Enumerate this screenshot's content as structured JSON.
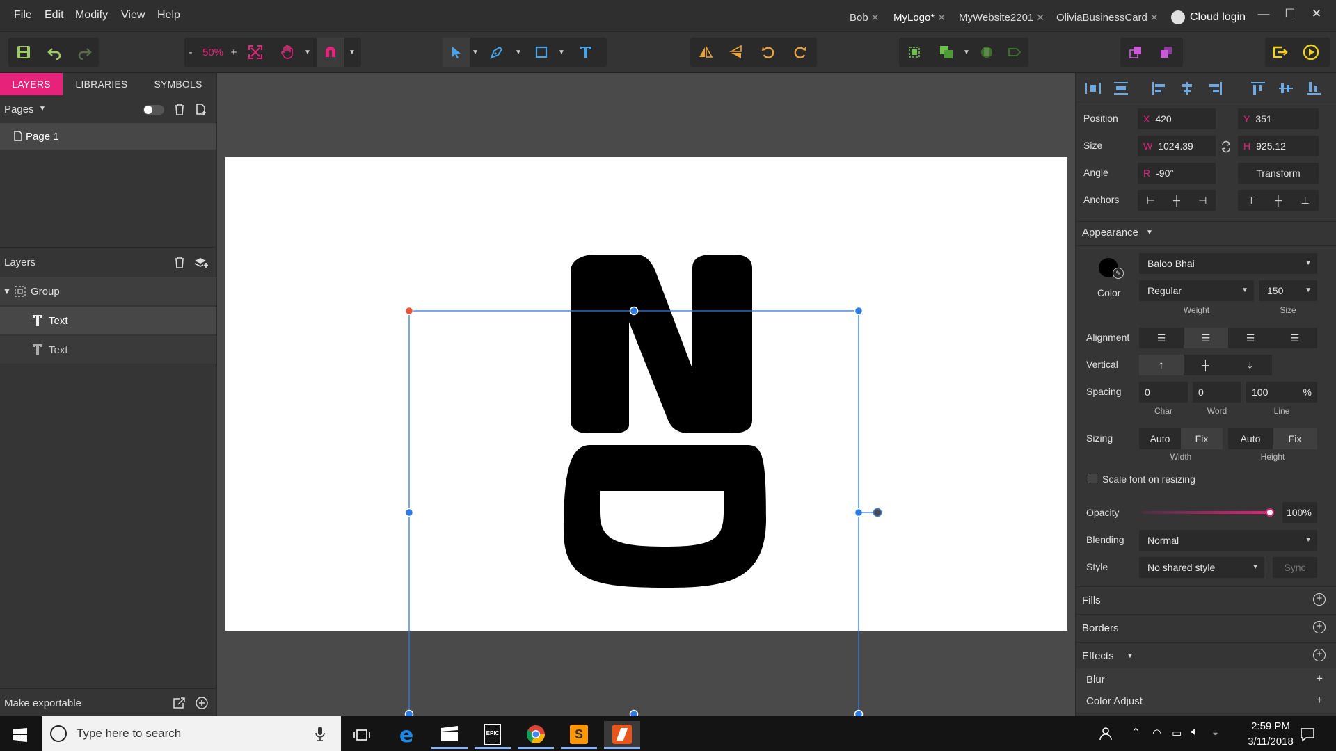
{
  "menu": [
    "File",
    "Edit",
    "Modify",
    "View",
    "Help"
  ],
  "doc_tabs": [
    {
      "label": "Bob",
      "active": false
    },
    {
      "label": "MyLogo*",
      "active": true
    },
    {
      "label": "MyWebsite2201",
      "active": false
    },
    {
      "label": "OliviaBusinessCard",
      "active": false
    }
  ],
  "cloud_login": "Cloud login",
  "toolbar": {
    "zoom_minus": "-",
    "zoom_value": "50%",
    "zoom_plus": "+"
  },
  "left_panel": {
    "tabs": [
      "LAYERS",
      "LIBRARIES",
      "SYMBOLS"
    ],
    "pages_label": "Pages",
    "page_item": "Page 1",
    "layers_label": "Layers",
    "layer_items": [
      {
        "label": "Group",
        "type": "group"
      },
      {
        "label": "Text",
        "type": "text",
        "selected": true
      },
      {
        "label": "Text",
        "type": "text",
        "selected": false
      }
    ],
    "make_exportable": "Make exportable"
  },
  "canvas": {
    "artboard_text": [
      "N",
      "D"
    ],
    "text_color": "#000000",
    "selection_color": "#2f7be5",
    "anchor_color": "#e8553b"
  },
  "right_panel": {
    "position_label": "Position",
    "x_prefix": "X",
    "x_value": "420",
    "y_prefix": "Y",
    "y_value": "351",
    "size_label": "Size",
    "w_prefix": "W",
    "w_value": "1024.39",
    "h_prefix": "H",
    "h_value": "925.12",
    "angle_label": "Angle",
    "r_prefix": "R",
    "r_value": "-90°",
    "transform_button": "Transform",
    "anchors_label": "Anchors",
    "appearance_label": "Appearance",
    "font_family": "Baloo Bhai",
    "color_label": "Color",
    "color_value": "#000000",
    "font_weight": "Regular",
    "weight_label": "Weight",
    "font_size": "150",
    "size_sub_label": "Size",
    "alignment_label": "Alignment",
    "vertical_label": "Vertical",
    "spacing_label": "Spacing",
    "char_spacing": "0",
    "word_spacing": "0",
    "line_spacing": "100",
    "percent": "%",
    "char_label": "Char",
    "word_label": "Word",
    "line_label": "Line",
    "sizing_label": "Sizing",
    "auto": "Auto",
    "fix": "Fix",
    "width_label": "Width",
    "height_label": "Height",
    "scale_font": "Scale font on resizing",
    "opacity_label": "Opacity",
    "opacity_value": "100%",
    "opacity_fraction": 1.0,
    "blending_label": "Blending",
    "blending_value": "Normal",
    "style_label": "Style",
    "style_value": "No shared style",
    "sync_button": "Sync",
    "fills_label": "Fills",
    "borders_label": "Borders",
    "effects_label": "Effects",
    "blur_label": "Blur",
    "color_adjust_label": "Color Adjust",
    "accent": "#e6227a"
  },
  "taskbar": {
    "search_placeholder": "Type here to search",
    "time": "2:59 PM",
    "date": "3/11/2018",
    "epic_label": "EPIC"
  }
}
